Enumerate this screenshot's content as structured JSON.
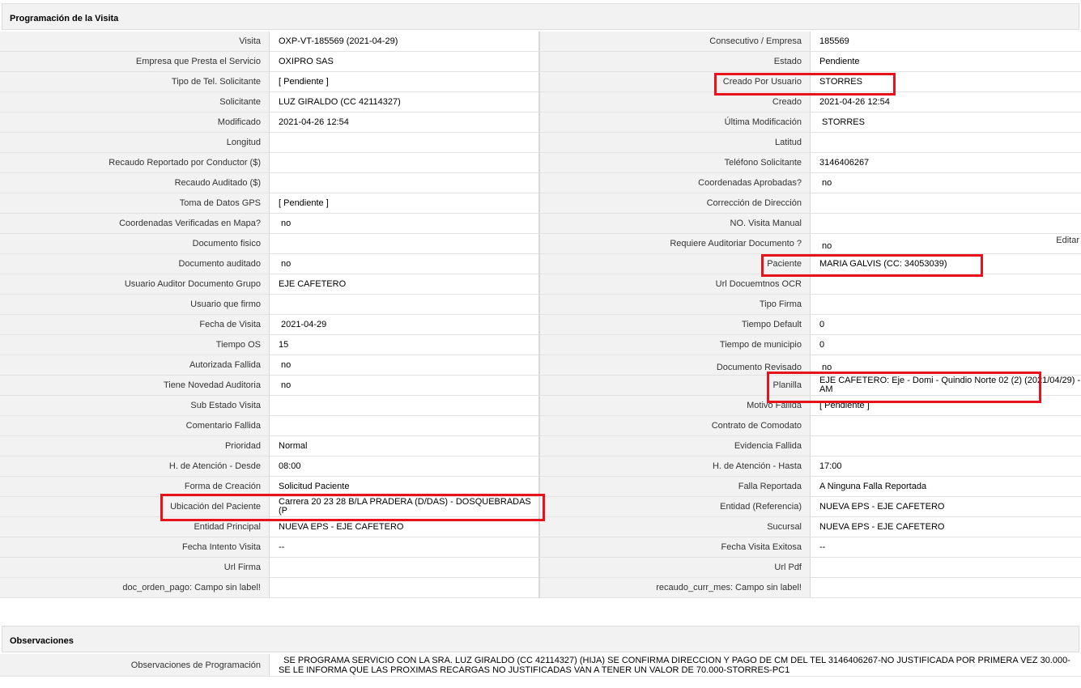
{
  "section_title": "Programación de la Visita",
  "edit_label": "Editar",
  "rows": [
    {
      "l1": "Visita",
      "v1": "OXP-VT-185569 (2021-04-29)",
      "l2": "Consecutivo / Empresa",
      "v2": "185569"
    },
    {
      "l1": "Empresa que Presta el Servicio",
      "v1": "OXIPRO SAS",
      "l2": "Estado",
      "v2": "Pendiente"
    },
    {
      "l1": "Tipo de Tel. Solicitante",
      "v1": "[ Pendiente ]",
      "l2": "Creado Por Usuario",
      "v2": "STORRES"
    },
    {
      "l1": "Solicitante",
      "v1": "LUZ GIRALDO (CC 42114327)",
      "l2": "Creado",
      "v2": "2021-04-26 12:54"
    },
    {
      "l1": "Modificado",
      "v1": "2021-04-26 12:54",
      "l2": "Última Modificación",
      "v2": "STORRES"
    },
    {
      "l1": "Longitud",
      "v1": "",
      "l2": "Latitud",
      "v2": ""
    },
    {
      "l1": "Recaudo Reportado por Conductor ($)",
      "v1": "",
      "l2": "Teléfono Solicitante",
      "v2": "3146406267"
    },
    {
      "l1": "Recaudo Auditado ($)",
      "v1": "",
      "l2": "Coordenadas Aprobadas?",
      "v2": "no"
    },
    {
      "l1": "Toma de Datos GPS",
      "v1": "[ Pendiente ]",
      "l2": "Corrección de Dirección",
      "v2": ""
    },
    {
      "l1": "Coordenadas Verificadas en Mapa?",
      "v1": "no",
      "l2": "NO. Visita Manual",
      "v2": ""
    },
    {
      "l1": "Documento fisico",
      "v1": "",
      "l2": "Requiere Auditoriar Documento ?",
      "v2": "no"
    },
    {
      "l1": "Documento auditado",
      "v1": "no",
      "l2": "Paciente",
      "v2": "MARIA GALVIS (CC: 34053039)"
    },
    {
      "l1": "Usuario Auditor Documento Grupo",
      "v1": "EJE CAFETERO",
      "l2": "Url Docuemtnos OCR",
      "v2": ""
    },
    {
      "l1": "Usuario que firmo",
      "v1": "",
      "l2": "Tipo Firma",
      "v2": ""
    },
    {
      "l1": "Fecha de Visita",
      "v1": "2021-04-29",
      "l2": "Tiempo Default",
      "v2": "0"
    },
    {
      "l1": "Tiempo OS",
      "v1": "15",
      "l2": "Tiempo de municipio",
      "v2": "0"
    },
    {
      "l1": "Autorizada Fallida",
      "v1": "no",
      "l2": "Documento Revisado",
      "v2": "no"
    },
    {
      "l1": "Tiene Novedad Auditoria",
      "v1": "no",
      "l2": "Planilla",
      "v2": "EJE CAFETERO: Eje - Domi - Quindio Norte 02 (2) (2021/04/29) - AM"
    },
    {
      "l1": "Sub Estado Visita",
      "v1": "",
      "l2": "Motivo Fallida",
      "v2": "[ Pendiente ]"
    },
    {
      "l1": "Comentario Fallida",
      "v1": "",
      "l2": "Contrato de Comodato",
      "v2": ""
    },
    {
      "l1": "Prioridad",
      "v1": "Normal",
      "l2": "Evidencia Fallida",
      "v2": ""
    },
    {
      "l1": "H. de Atención - Desde",
      "v1": "08:00",
      "l2": "H. de Atención - Hasta",
      "v2": "17:00"
    },
    {
      "l1": "Forma de Creación",
      "v1": "Solicitud Paciente",
      "l2": "Falla Reportada",
      "v2": "A Ninguna Falla Reportada"
    },
    {
      "l1": "Ubicación del Paciente",
      "v1": "Carrera 20 23 28 B/LA PRADERA (D/DAS) - DOSQUEBRADAS (P",
      "l2": "Entidad (Referencia)",
      "v2": "NUEVA EPS - EJE CAFETERO"
    },
    {
      "l1": "Entidad Principal",
      "v1": "NUEVA EPS - EJE CAFETERO",
      "l2": "Sucursal",
      "v2": "NUEVA EPS - EJE CAFETERO"
    },
    {
      "l1": "Fecha Intento Visita",
      "v1": "--",
      "l2": "Fecha Visita Exitosa",
      "v2": "--"
    },
    {
      "l1": "Url Firma",
      "v1": "",
      "l2": "Url Pdf",
      "v2": ""
    },
    {
      "l1": "doc_orden_pago: Campo sin label!",
      "v1": "",
      "l2": "recaudo_curr_mes: Campo sin label!",
      "v2": ""
    }
  ],
  "observaciones": {
    "title": "Observaciones",
    "label": "Observaciones de Programación",
    "value": "SE PROGRAMA SERVICIO CON LA SRA. LUZ GIRALDO (CC 42114327) (HIJA) SE CONFIRMA DIRECCION Y PAGO DE CM DEL TEL 3146406267-NO JUSTIFICADA POR PRIMERA VEZ 30.000-SE LE INFORMA QUE LAS PROXIMAS RECARGAS NO JUSTIFICADAS VAN A TENER UN VALOR DE 70.000-STORRES-PC1"
  },
  "highlight_color": "#e8121b"
}
